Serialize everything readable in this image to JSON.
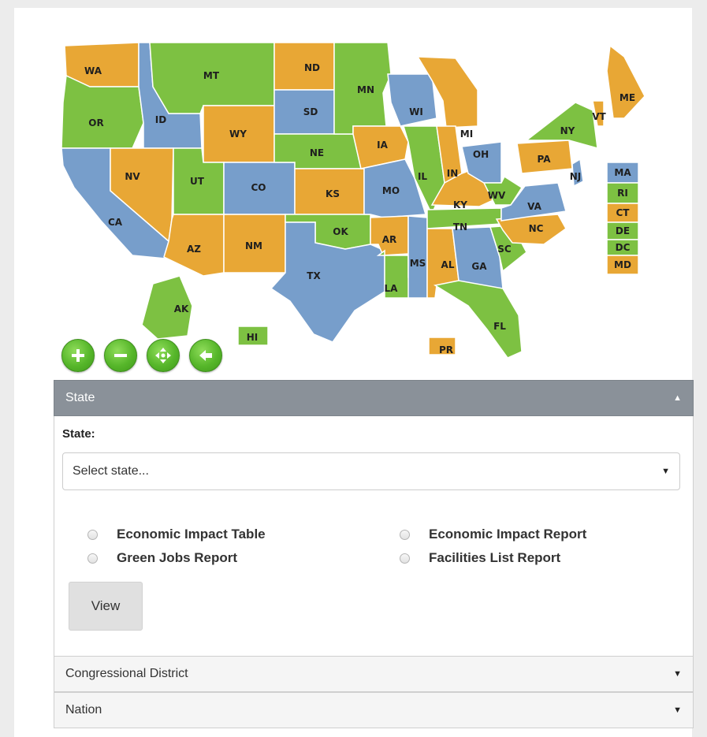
{
  "map": {
    "colors": {
      "orange": "#e8a735",
      "green": "#7dc142",
      "blue": "#779ecb"
    },
    "states": [
      {
        "abbr": "WA",
        "color": "orange"
      },
      {
        "abbr": "OR",
        "color": "green"
      },
      {
        "abbr": "CA",
        "color": "blue"
      },
      {
        "abbr": "ID",
        "color": "blue"
      },
      {
        "abbr": "NV",
        "color": "orange"
      },
      {
        "abbr": "MT",
        "color": "green"
      },
      {
        "abbr": "WY",
        "color": "orange"
      },
      {
        "abbr": "UT",
        "color": "green"
      },
      {
        "abbr": "AZ",
        "color": "orange"
      },
      {
        "abbr": "CO",
        "color": "blue"
      },
      {
        "abbr": "NM",
        "color": "orange"
      },
      {
        "abbr": "ND",
        "color": "orange"
      },
      {
        "abbr": "SD",
        "color": "blue"
      },
      {
        "abbr": "NE",
        "color": "green"
      },
      {
        "abbr": "KS",
        "color": "orange"
      },
      {
        "abbr": "OK",
        "color": "green"
      },
      {
        "abbr": "TX",
        "color": "blue"
      },
      {
        "abbr": "MN",
        "color": "green"
      },
      {
        "abbr": "IA",
        "color": "orange"
      },
      {
        "abbr": "MO",
        "color": "blue"
      },
      {
        "abbr": "AR",
        "color": "orange"
      },
      {
        "abbr": "LA",
        "color": "green"
      },
      {
        "abbr": "WI",
        "color": "blue"
      },
      {
        "abbr": "IL",
        "color": "green"
      },
      {
        "abbr": "MS",
        "color": "blue"
      },
      {
        "abbr": "MI",
        "color": "orange"
      },
      {
        "abbr": "IN",
        "color": "orange"
      },
      {
        "abbr": "KY",
        "color": "orange"
      },
      {
        "abbr": "TN",
        "color": "green"
      },
      {
        "abbr": "AL",
        "color": "orange"
      },
      {
        "abbr": "OH",
        "color": "blue"
      },
      {
        "abbr": "WV",
        "color": "green"
      },
      {
        "abbr": "GA",
        "color": "blue"
      },
      {
        "abbr": "FL",
        "color": "green"
      },
      {
        "abbr": "SC",
        "color": "green"
      },
      {
        "abbr": "NC",
        "color": "orange"
      },
      {
        "abbr": "VA",
        "color": "blue"
      },
      {
        "abbr": "PA",
        "color": "orange"
      },
      {
        "abbr": "NY",
        "color": "green"
      },
      {
        "abbr": "VT",
        "color": "orange"
      },
      {
        "abbr": "ME",
        "color": "orange"
      },
      {
        "abbr": "NJ",
        "color": "blue"
      },
      {
        "abbr": "AK",
        "color": "green"
      },
      {
        "abbr": "HI",
        "color": "green"
      },
      {
        "abbr": "PR",
        "color": "orange"
      },
      {
        "abbr": "MA",
        "color": "blue"
      },
      {
        "abbr": "RI",
        "color": "green"
      },
      {
        "abbr": "CT",
        "color": "orange"
      },
      {
        "abbr": "DE",
        "color": "green"
      },
      {
        "abbr": "DC",
        "color": "green"
      },
      {
        "abbr": "MD",
        "color": "orange"
      }
    ],
    "controls": [
      {
        "name": "zoom-in-icon"
      },
      {
        "name": "zoom-out-icon"
      },
      {
        "name": "pan-icon"
      },
      {
        "name": "back-arrow-icon"
      }
    ]
  },
  "state_panel": {
    "title": "State",
    "field_label": "State:",
    "select_value": "Select state...",
    "radios": [
      {
        "label": "Economic Impact Table"
      },
      {
        "label": "Economic Impact Report"
      },
      {
        "label": "Green Jobs Report"
      },
      {
        "label": "Facilities List Report"
      }
    ],
    "view_label": "View"
  },
  "collapsed_panels": [
    {
      "title": "Congressional District"
    },
    {
      "title": "Nation"
    }
  ],
  "arrows": {
    "up": "▲",
    "down": "▼"
  }
}
